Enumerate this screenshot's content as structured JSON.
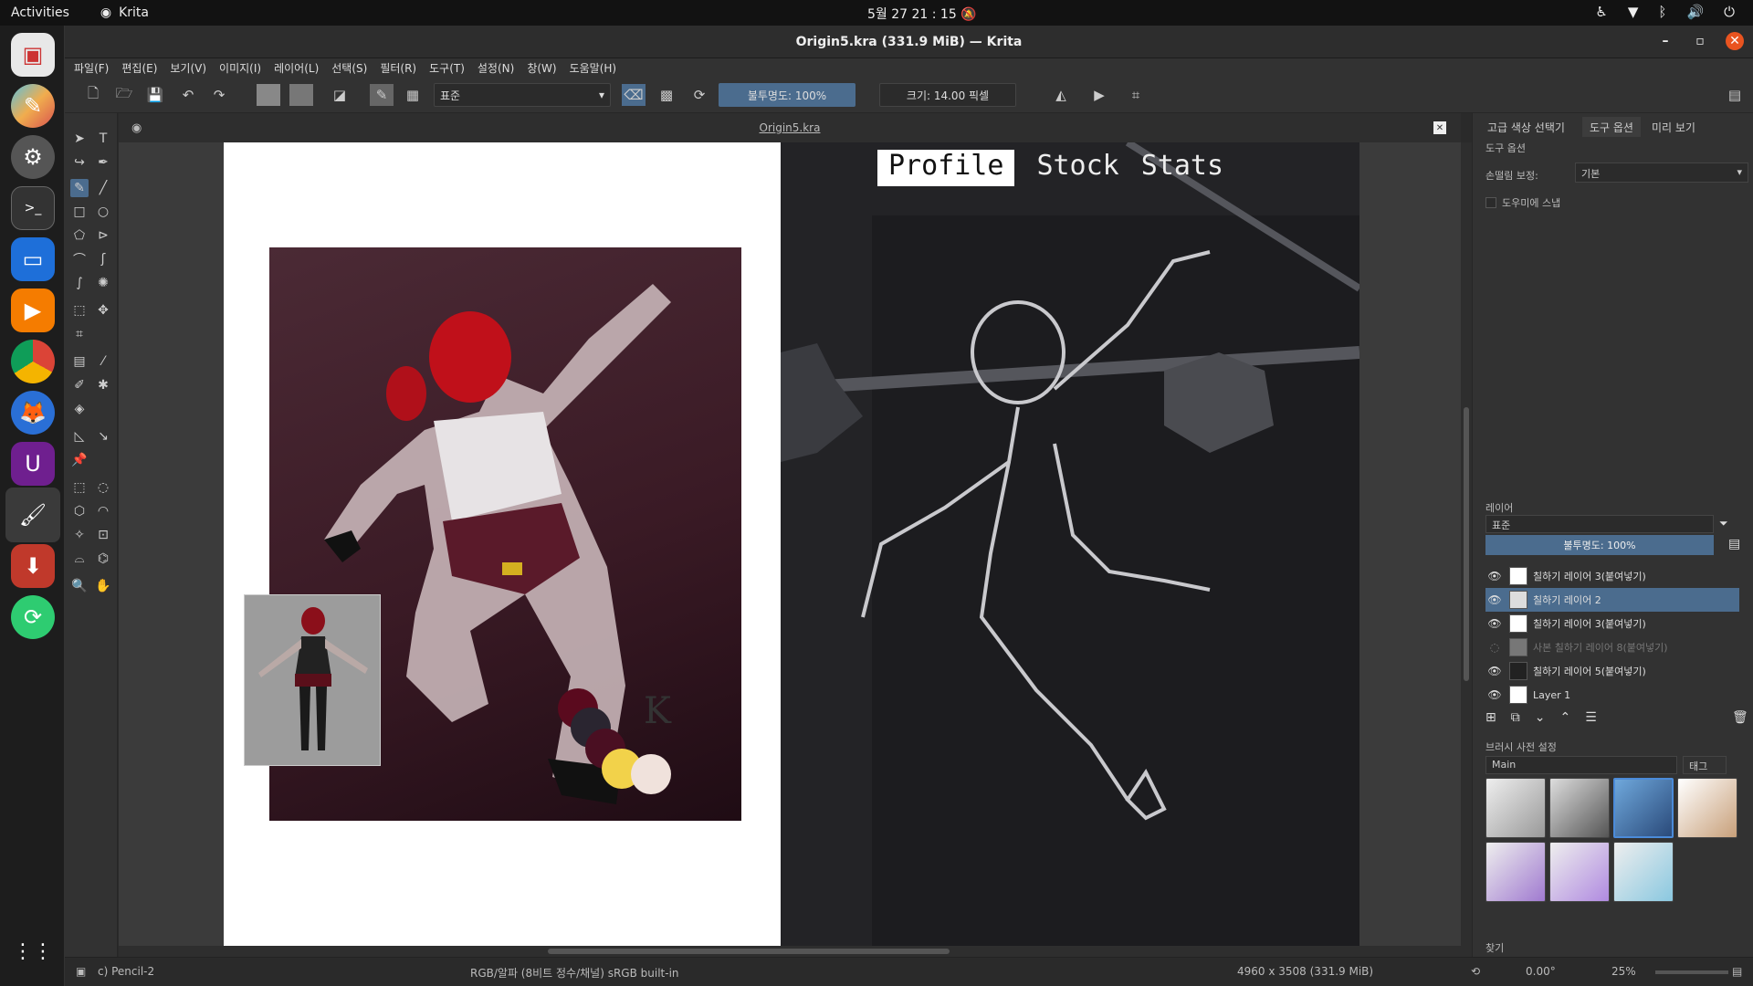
{
  "system": {
    "activities": "Activities",
    "app_name": "Krita",
    "clock": "5월 27  21 : 15"
  },
  "window": {
    "title": "Origin5.kra (331.9 MiB) — Krita"
  },
  "menu": [
    "파일(F)",
    "편집(E)",
    "보기(V)",
    "이미지(I)",
    "레이어(L)",
    "선택(S)",
    "필터(R)",
    "도구(T)",
    "설정(N)",
    "창(W)",
    "도움말(H)"
  ],
  "toolbar": {
    "blend_mode": "표준",
    "opacity": "불투명도: 100%",
    "size": "크기: 14.00 픽셀"
  },
  "document": {
    "tab": "Origin5.kra",
    "nav": [
      "Profile",
      "Stock",
      "Stats"
    ],
    "signature": "K"
  },
  "dockers": {
    "tabs": [
      "고급 색상 선택기",
      "도구 옵션",
      "미리 보기"
    ],
    "tool_options_title": "도구 옵션",
    "smoothing_label": "손떨림 보정:",
    "smoothing_value": "기본",
    "snap_label": "도우미에 스냅",
    "layers_title": "레이어",
    "layers_blend": "표준",
    "layers_opacity": "불투명도:  100%",
    "layers": [
      {
        "name": "칠하기 레이어 3(붙여넣기)",
        "visible": true,
        "selected": false
      },
      {
        "name": "칠하기 레이어 2",
        "visible": true,
        "selected": true
      },
      {
        "name": "칠하기 레이어 3(붙여넣기)",
        "visible": true,
        "selected": false
      },
      {
        "name": "사본 칠하기 레이어 8(붙여넣기)",
        "visible": false,
        "selected": false
      },
      {
        "name": "칠하기 레이어 5(붙여넣기)",
        "visible": true,
        "selected": false
      },
      {
        "name": "Layer 1",
        "visible": true,
        "selected": false
      }
    ],
    "brush_presets_title": "브러시 사전 설정",
    "brush_group": "Main",
    "brush_tag": "태그",
    "search_label": "찾기"
  },
  "status": {
    "brush": "c) Pencil-2",
    "color_space": "RGB/알파 (8비트 정수/채널)  sRGB built-in",
    "image_size": "4960 x 3508 (331.9 MiB)",
    "rotation": "0.00°",
    "zoom": "25%"
  },
  "colors": {
    "accent": "#4b6c8e",
    "palette": [
      "#5a0a1e",
      "#2a2530",
      "#4a0f22",
      "#f2d24a",
      "#f0e2dc"
    ]
  }
}
